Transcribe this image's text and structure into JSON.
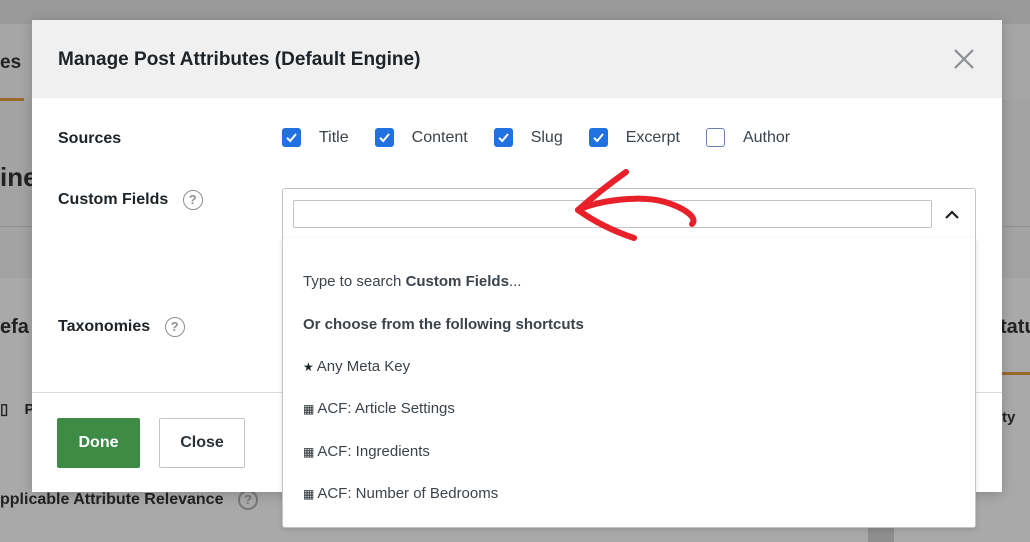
{
  "background": {
    "tab_fragment": "es",
    "heading_fragment": "ine",
    "panel_left_fragment": "efa",
    "panel_right_fragment": "tatu",
    "row_left_fragment": "P",
    "row_right_fragment": "ty",
    "bottom_label": "pplicable Attribute Relevance",
    "bottom_help": "?"
  },
  "modal": {
    "title": "Manage Post Attributes (Default Engine)",
    "close_glyph": "×",
    "sources_label": "Sources",
    "sources": [
      {
        "label": "Title",
        "checked": true
      },
      {
        "label": "Content",
        "checked": true
      },
      {
        "label": "Slug",
        "checked": true
      },
      {
        "label": "Excerpt",
        "checked": true
      },
      {
        "label": "Author",
        "checked": false
      }
    ],
    "custom_fields_label": "Custom Fields",
    "taxonomies_label": "Taxonomies",
    "help_glyph": "?",
    "search_value": "",
    "done_label": "Done",
    "close_label": "Close"
  },
  "dropdown": {
    "hint_prefix": "Type to search ",
    "hint_bold": "Custom Fields",
    "hint_suffix": "...",
    "shortcuts_heading": "Or choose from the following shortcuts",
    "options": [
      {
        "icon": "★",
        "icon_name": "star-icon",
        "label": "Any Meta Key"
      },
      {
        "icon": "▦",
        "icon_name": "table-icon",
        "label": "ACF: Article Settings"
      },
      {
        "icon": "▦",
        "icon_name": "table-icon",
        "label": "ACF: Ingredients"
      },
      {
        "icon": "▦",
        "icon_name": "table-icon",
        "label": "ACF: Number of Bedrooms"
      }
    ]
  },
  "colors": {
    "checkbox_accent": "#2271e0",
    "done_button": "#3d8b45",
    "annotation_arrow": "#e8202a"
  }
}
